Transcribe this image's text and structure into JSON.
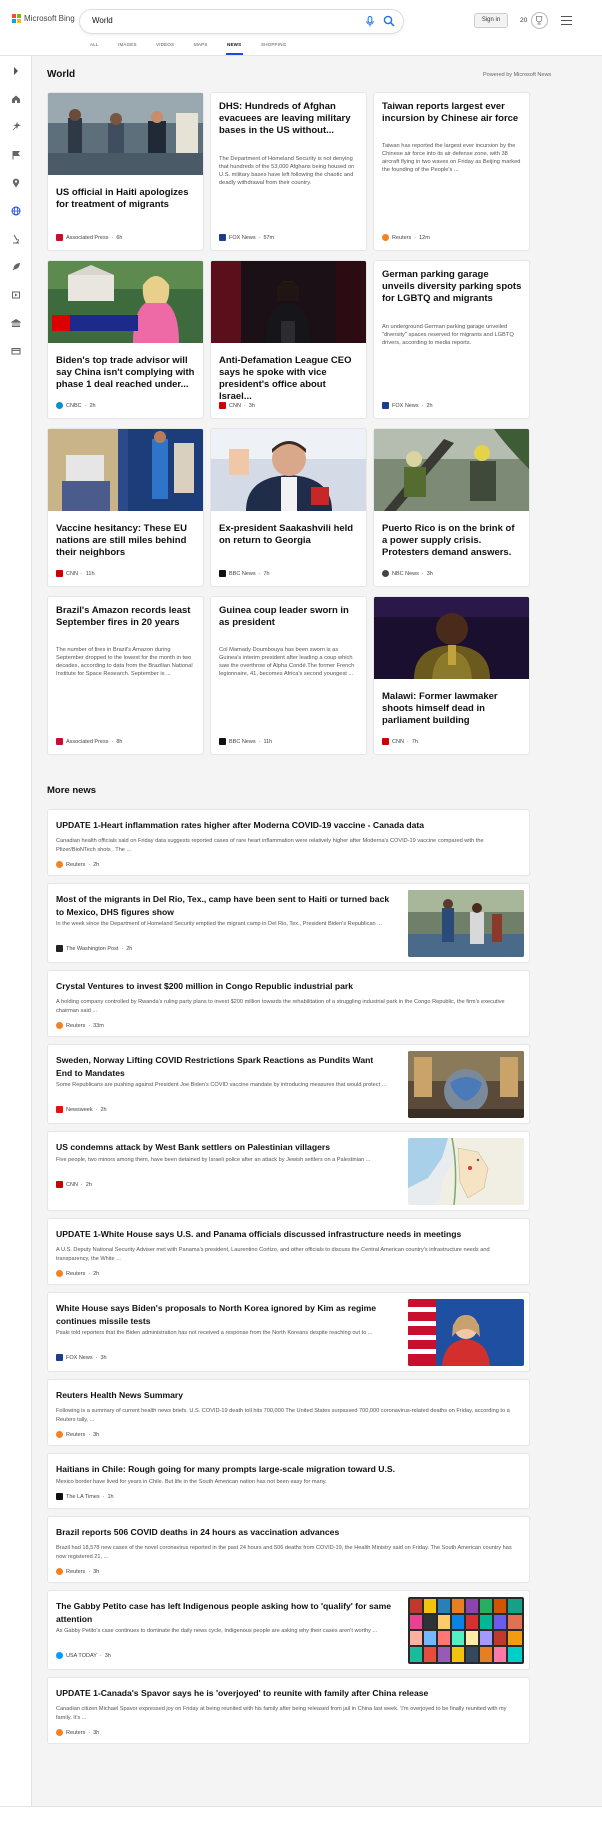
{
  "brand": {
    "name": "Microsoft Bing"
  },
  "search": {
    "query": "World"
  },
  "header": {
    "signin_label": "Sign in",
    "points": "20"
  },
  "scopes": [
    "ALL",
    "IMAGES",
    "VIDEOS",
    "MAPS",
    "NEWS",
    "SHOPPING"
  ],
  "active_scope": "NEWS",
  "section": {
    "title": "World",
    "powered_by": "Powered by Microsoft News"
  },
  "cards": [
    {
      "title": "US official in Haiti apologizes for treatment of migrants",
      "snippet": "",
      "source": "Associated Press",
      "age": "6h",
      "has_image": true,
      "logo_color": "#c8102e"
    },
    {
      "title": "DHS: Hundreds of Afghan evacuees are leaving military bases in the US without...",
      "snippet": "The Department of Homeland Security is not denying that hundreds of the 53,000 Afghans being housed on U.S. military bases have left following the chaotic and deadly withdrawal from their country.",
      "source": "FOX News",
      "age": "57m",
      "has_image": false,
      "logo_color": "#1a3e8c"
    },
    {
      "title": "Taiwan reports largest ever incursion by Chinese air force",
      "snippet": "Taiwan has reported the largest ever incursion by the Chinese air force into its air defense zone, with 38 aircraft flying in two waves on Friday as Beijing marked the founding of the People's ...",
      "source": "Reuters",
      "age": "12m",
      "has_image": false,
      "logo_color": "#f58220"
    },
    {
      "title": "Biden's top trade advisor will say China isn't complying with phase 1 deal reached under...",
      "snippet": "",
      "source": "CNBC",
      "age": "2h",
      "has_image": true,
      "logo_color": "#0a8fd6"
    },
    {
      "title": "Anti-Defamation League CEO says he spoke with vice president's office about Israel...",
      "snippet": "",
      "source": "CNN",
      "age": "3h",
      "has_image": true,
      "logo_color": "#cc0000"
    },
    {
      "title": "German parking garage unveils diversity parking spots for LGBTQ and migrants",
      "snippet": "An underground German parking garage unveiled \"diversity\" spaces reserved for migrants and LGBTQ drivers, according to media reports.",
      "source": "FOX News",
      "age": "2h",
      "has_image": false,
      "logo_color": "#1a3e8c"
    },
    {
      "title": "Vaccine hesitancy: These EU nations are still miles behind their neighbors",
      "snippet": "",
      "source": "CNN",
      "age": "11h",
      "has_image": true,
      "logo_color": "#cc0000"
    },
    {
      "title": "Ex-president Saakashvili held on return to Georgia",
      "snippet": "",
      "source": "BBC News",
      "age": "7h",
      "has_image": true,
      "logo_color": "#111111"
    },
    {
      "title": "Puerto Rico is on the brink of a power supply crisis. Protesters demand answers.",
      "snippet": "",
      "source": "NBC News",
      "age": "3h",
      "has_image": true,
      "logo_color": "#444444"
    },
    {
      "title": "Brazil's Amazon records least September fires in 20 years",
      "snippet": "The number of fires in Brazil's Amazon during September dropped to the lowest for the month in two decades, according to data from the Brazilian National Institute for Space Research. September is ...",
      "source": "Associated Press",
      "age": "8h",
      "has_image": false,
      "logo_color": "#c8102e"
    },
    {
      "title": "Guinea coup leader sworn in as president",
      "snippet": "Col Mamady Doumbouya has been sworn is as Guinea's interim president after leading a coup which saw the overthrow of Alpha Condé.The former French legionnaire, 41, becomes Africa's second youngest ...",
      "source": "BBC News",
      "age": "11h",
      "has_image": false,
      "logo_color": "#111111"
    },
    {
      "title": "Malawi: Former lawmaker shoots himself dead in parliament building",
      "snippet": "",
      "source": "CNN",
      "age": "7h",
      "has_image": true,
      "logo_color": "#cc0000"
    }
  ],
  "more_news": {
    "title": "More news",
    "items": [
      {
        "title": "UPDATE 1-Heart inflammation rates higher after Moderna COVID-19 vaccine - Canada data",
        "snippet": "Canadian health officials said on Friday data suggests reported cases of rare heart inflammation were relatively higher after Moderna's COVID-19 vaccine compared with the Pfizer/BioNTech shots . The ...",
        "source": "Reuters",
        "age": "2h",
        "has_thumb": false,
        "logo_color": "#f58220"
      },
      {
        "title": "Most of the migrants in Del Rio, Tex., camp have been sent to Haiti or turned back to Mexico, DHS figures show",
        "snippet": "In the week since the Department of Homeland Security emptied the migrant camp in Del Rio, Tex., President Biden's Republican ...",
        "source": "The Washington Post",
        "age": "2h",
        "has_thumb": true,
        "logo_color": "#222222"
      },
      {
        "title": "Crystal Ventures to invest $200 million in Congo Republic industrial park",
        "snippet": "A holding company controlled by Rwanda's ruling party plans to invest $200 million towards the rehabilitation of a struggling industrial park in the Congo Republic, the firm's executive chairman said ...",
        "source": "Reuters",
        "age": "33m",
        "has_thumb": false,
        "logo_color": "#f58220"
      },
      {
        "title": "Sweden, Norway Lifting COVID Restrictions Spark Reactions as Pundits Want End to Mandates",
        "snippet": "Some Republicans are pushing against President Joe Biden's COVID vaccine mandate by introducing measures that would protect ...",
        "source": "Newsweek",
        "age": "2h",
        "has_thumb": true,
        "logo_color": "#e3120b"
      },
      {
        "title": "US condemns attack by West Bank settlers on Palestinian villagers",
        "snippet": "Five people, two minors among them, have been detained by Israeli police after an attack by Jewish settlers on a Palestinian ...",
        "source": "CNN",
        "age": "2h",
        "has_thumb": true,
        "logo_color": "#cc0000"
      },
      {
        "title": "UPDATE 1-White House says U.S. and Panama officials discussed infrastructure needs in meetings",
        "snippet": "A U.S. Deputy National Security Adviser met with Panama's president, Laurentino Cortizo, and other officials to discuss the Central American country's infrastructure needs and transparency, the White ...",
        "source": "Reuters",
        "age": "2h",
        "has_thumb": false,
        "logo_color": "#f58220"
      },
      {
        "title": "White House says Biden's proposals to North Korea ignored by Kim as regime continues missile tests",
        "snippet": "Psaki told reporters that the Biden administration has not received a response from the North Koreans despite reaching out to ...",
        "source": "FOX News",
        "age": "3h",
        "has_thumb": true,
        "logo_color": "#1a3e8c"
      },
      {
        "title": "Reuters Health News Summary",
        "snippet": "Following is a summary of current health news briefs. U.S. COVID-19 death toll hits 700,000 The United States surpassed 700,000 coronavirus-related deaths on Friday, according to a Reuters tally, ...",
        "source": "Reuters",
        "age": "3h",
        "has_thumb": false,
        "logo_color": "#f58220"
      },
      {
        "title": "Haitians in Chile: Rough going for many prompts large-scale migration toward U.S.",
        "snippet": "Mexico border have lived for years in Chile. But life in the South American nation has not been easy for many.",
        "source": "The LA Times",
        "age": "1h",
        "has_thumb": false,
        "logo_color": "#111111"
      },
      {
        "title": "Brazil reports 506 COVID deaths in 24 hours as vaccination advances",
        "snippet": "Brazil had 18,578 new cases of the novel coronavirus reported in the past 24 hours and 506 deaths from COVID-19, the Health Ministry said on Friday. The South American country has now registered 21, ...",
        "source": "Reuters",
        "age": "3h",
        "has_thumb": false,
        "logo_color": "#f58220"
      },
      {
        "title": "The Gabby Petito case has left Indigenous people asking how to 'qualify' for same attention",
        "snippet": "As Gabby Petito's case continues to dominate the daily news cycle, Indigenous people are asking why their cases aren't worthy ...",
        "source": "USA TODAY",
        "age": "3h",
        "has_thumb": true,
        "logo_color": "#009bff"
      },
      {
        "title": "UPDATE 1-Canada's Spavor says he is 'overjoyed' to reunite with family after China release",
        "snippet": "Canadian citizen Michael Spavor expressed joy on Friday at being reunited with his family after being released from jail in China last week. 'I'm overjoyed to be finally reunited with my family. It's ...",
        "source": "Reuters",
        "age": "3h",
        "has_thumb": false,
        "logo_color": "#f58220"
      }
    ]
  },
  "rail_icons": [
    "expand-icon",
    "home-icon",
    "sparkle-icon",
    "flag-icon",
    "location-pin-icon",
    "globe-icon",
    "microscope-icon",
    "rocket-icon",
    "film-icon",
    "bank-icon",
    "card-icon"
  ],
  "colors": {
    "accent": "#174ae4",
    "background": "#f4f4f4",
    "card": "#ffffff"
  }
}
